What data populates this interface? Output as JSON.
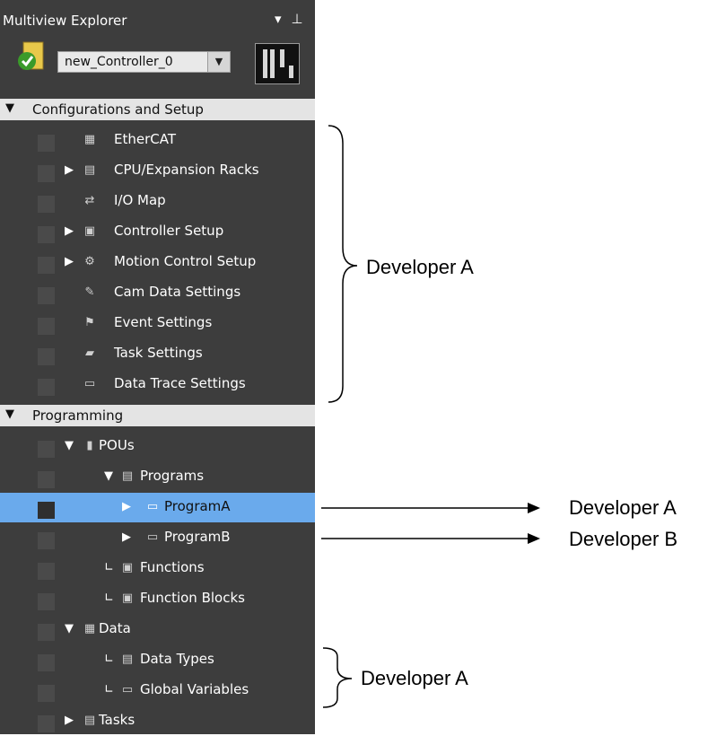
{
  "panel": {
    "title": "Multiview Explorer",
    "title_controls": {
      "dropdown": "▾",
      "pin": "⊥"
    },
    "controller_select": {
      "value": "new_Controller_0",
      "arrow": "▼"
    }
  },
  "tree": {
    "sections": [
      {
        "id": "config",
        "label": "Configurations and Setup",
        "expanded": true
      },
      {
        "id": "programming",
        "label": "Programming",
        "expanded": true
      }
    ],
    "config_items": [
      {
        "label": "EtherCAT",
        "icon": "ethercat-icon",
        "expander": ""
      },
      {
        "label": "CPU/Expansion Racks",
        "icon": "rack-icon",
        "expander": "▶"
      },
      {
        "label": "I/O Map",
        "icon": "io-map-icon",
        "expander": ""
      },
      {
        "label": "Controller Setup",
        "icon": "controller-setup-icon",
        "expander": "▶"
      },
      {
        "label": "Motion Control Setup",
        "icon": "motion-gear-icon",
        "expander": "▶"
      },
      {
        "label": "Cam Data Settings",
        "icon": "cam-icon",
        "expander": ""
      },
      {
        "label": "Event Settings",
        "icon": "flag-icon",
        "expander": ""
      },
      {
        "label": "Task Settings",
        "icon": "task-folder-icon",
        "expander": ""
      },
      {
        "label": "Data Trace Settings",
        "icon": "trace-icon",
        "expander": ""
      }
    ],
    "programming_items": [
      {
        "label": "POUs",
        "icon": "pou-icon",
        "expander": "▼",
        "level": 1
      },
      {
        "label": "Programs",
        "icon": "programs-icon",
        "expander": "▼",
        "level": 2
      },
      {
        "label": "ProgramA",
        "icon": "program-icon",
        "expander": "▶",
        "level": 3,
        "selected": true
      },
      {
        "label": "ProgramB",
        "icon": "program-icon",
        "expander": "▶",
        "level": 3
      },
      {
        "label": "Functions",
        "icon": "functions-icon",
        "expander": "∟",
        "level": 2
      },
      {
        "label": "Function Blocks",
        "icon": "function-blocks-icon",
        "expander": "∟",
        "level": 2
      },
      {
        "label": "Data",
        "icon": "data-table-icon",
        "expander": "▼",
        "level": 1
      },
      {
        "label": "Data Types",
        "icon": "data-types-icon",
        "expander": "∟",
        "level": 2
      },
      {
        "label": "Global Variables",
        "icon": "global-var-icon",
        "expander": "∟",
        "level": 2
      },
      {
        "label": "Tasks",
        "icon": "tasks-icon",
        "expander": "▶",
        "level": 1
      }
    ]
  },
  "annotations": {
    "config_group": "Developer A",
    "program_a": "Developer A",
    "program_b": "Developer B",
    "data_group": "Developer A"
  },
  "colors": {
    "panel_bg": "#3d3d3d",
    "section_bg": "#e4e4e4",
    "selected_bg": "#6aaaec",
    "text_light": "#ffffff"
  }
}
